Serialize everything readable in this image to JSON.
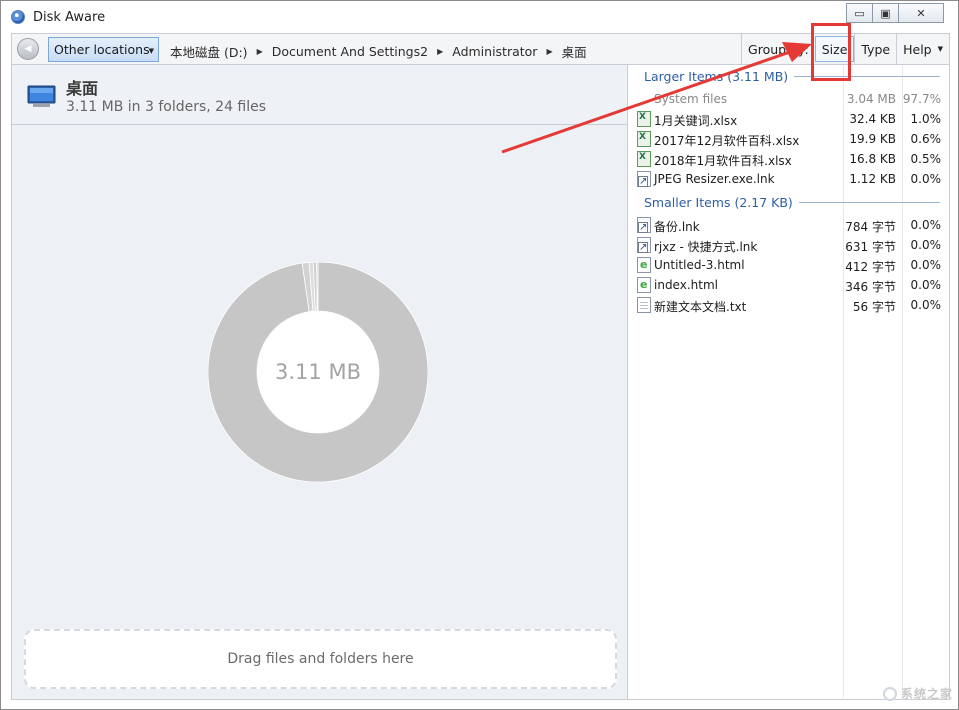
{
  "window": {
    "title": "Disk Aware",
    "minimize_glyph": "▭",
    "maximize_glyph": "▣",
    "close_glyph": "✕"
  },
  "toolbar": {
    "back_glyph": "◀",
    "location_button": "Other locations",
    "location_caret": "▼",
    "breadcrumbs": [
      "本地磁盘 (D:)",
      "Document And Settings2",
      "Administrator",
      "桌面"
    ],
    "breadcrumb_separator": "▶",
    "group_by_label": "Group by:",
    "size_button": "Size",
    "type_button": "Type",
    "help_button": "Help",
    "help_caret": "▼"
  },
  "folder": {
    "icon": "monitor-icon",
    "name": "桌面",
    "summary": "3.11 MB in 3 folders, 24 files",
    "total_label": "3.11 MB"
  },
  "chart_data": {
    "type": "pie",
    "style": "donut",
    "center_label": "3.11 MB",
    "slices": [
      {
        "label": "System files",
        "percent": 97.7,
        "color": "#c6c6c6"
      },
      {
        "label": "1月关键词.xlsx",
        "percent": 1.0,
        "color": "#d2d2d2"
      },
      {
        "label": "2017年12月软件百科.xlsx",
        "percent": 0.6,
        "color": "#dcdcdc"
      },
      {
        "label": "2018年1月软件百科.xlsx",
        "percent": 0.5,
        "color": "#d0d0d0"
      },
      {
        "label": "JPEG Resizer.exe.lnk",
        "percent": 0.2,
        "color": "#c9c9c9"
      }
    ]
  },
  "dropzone": {
    "text": "Drag files and folders here"
  },
  "groups": {
    "larger": {
      "header": "Larger Items (3.11 MB)",
      "rows": [
        {
          "icon": "none",
          "name": "System files",
          "size": "3.04 MB",
          "pct": "97.7%"
        },
        {
          "icon": "xlsx",
          "name": "1月关键词.xlsx",
          "size": "32.4 KB",
          "pct": "1.0%"
        },
        {
          "icon": "xlsx",
          "name": "2017年12月软件百科.xlsx",
          "size": "19.9 KB",
          "pct": "0.6%"
        },
        {
          "icon": "xlsx",
          "name": "2018年1月软件百科.xlsx",
          "size": "16.8 KB",
          "pct": "0.5%"
        },
        {
          "icon": "lnk",
          "name": "JPEG Resizer.exe.lnk",
          "size": "1.12 KB",
          "pct": "0.0%"
        }
      ]
    },
    "smaller": {
      "header": "Smaller Items (2.17 KB)",
      "rows": [
        {
          "icon": "lnk",
          "name": "备份.lnk",
          "size": "784 字节",
          "pct": "0.0%"
        },
        {
          "icon": "lnk",
          "name": "rjxz - 快捷方式.lnk",
          "size": "631 字节",
          "pct": "0.0%"
        },
        {
          "icon": "html",
          "name": "Untitled-3.html",
          "size": "412 字节",
          "pct": "0.0%"
        },
        {
          "icon": "html",
          "name": "index.html",
          "size": "346 字节",
          "pct": "0.0%"
        },
        {
          "icon": "txt",
          "name": "新建文本文档.txt",
          "size": "56 字节",
          "pct": "0.0%"
        }
      ]
    }
  },
  "annotation": {
    "highlight_color": "#e53935"
  },
  "watermark": {
    "text": "系统之家"
  }
}
